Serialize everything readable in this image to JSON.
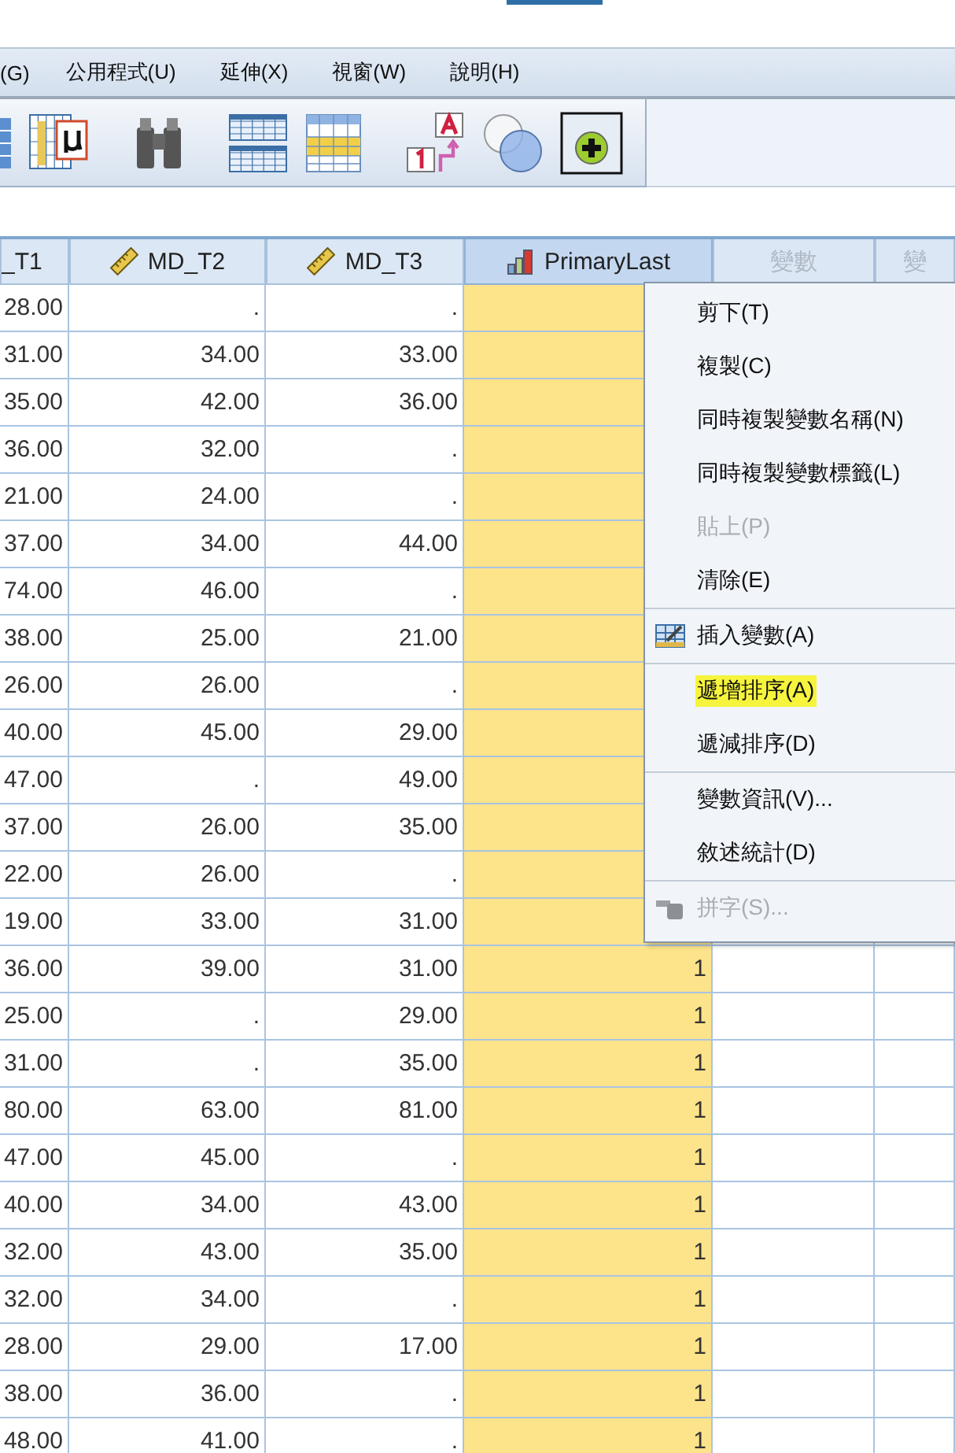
{
  "menu_bar": [
    {
      "label": "(G)"
    },
    {
      "label": "公用程式(U)"
    },
    {
      "label": "延伸(X)"
    },
    {
      "label": "視窗(W)"
    },
    {
      "label": "說明(H)"
    }
  ],
  "table": {
    "columns": [
      {
        "label": "_T1",
        "kind": "none",
        "selected": false
      },
      {
        "label": "MD_T2",
        "kind": "scale",
        "selected": false
      },
      {
        "label": "MD_T3",
        "kind": "scale",
        "selected": false
      },
      {
        "label": "PrimaryLast",
        "kind": "nominal",
        "selected": true
      },
      {
        "label": "變數",
        "kind": "empty",
        "selected": false
      },
      {
        "label": "變",
        "kind": "empty",
        "selected": false
      }
    ],
    "rows": [
      [
        "28.00",
        ".",
        "."
      ],
      [
        "31.00",
        "34.00",
        "33.00"
      ],
      [
        "35.00",
        "42.00",
        "36.00"
      ],
      [
        "36.00",
        "32.00",
        "."
      ],
      [
        "21.00",
        "24.00",
        "."
      ],
      [
        "37.00",
        "34.00",
        "44.00"
      ],
      [
        "74.00",
        "46.00",
        "."
      ],
      [
        "38.00",
        "25.00",
        "21.00"
      ],
      [
        "26.00",
        "26.00",
        "."
      ],
      [
        "40.00",
        "45.00",
        "29.00"
      ],
      [
        "47.00",
        ".",
        "49.00"
      ],
      [
        "37.00",
        "26.00",
        "35.00"
      ],
      [
        "22.00",
        "26.00",
        "."
      ],
      [
        "19.00",
        "33.00",
        "31.00"
      ],
      [
        "36.00",
        "39.00",
        "31.00",
        "1"
      ],
      [
        "25.00",
        ".",
        "29.00",
        "1"
      ],
      [
        "31.00",
        ".",
        "35.00",
        "1"
      ],
      [
        "80.00",
        "63.00",
        "81.00",
        "1"
      ],
      [
        "47.00",
        "45.00",
        ".",
        "1"
      ],
      [
        "40.00",
        "34.00",
        "43.00",
        "1"
      ],
      [
        "32.00",
        "43.00",
        "35.00",
        "1"
      ],
      [
        "32.00",
        "34.00",
        ".",
        "1"
      ],
      [
        "28.00",
        "29.00",
        "17.00",
        "1"
      ],
      [
        "38.00",
        "36.00",
        ".",
        "1"
      ],
      [
        "48.00",
        "41.00",
        ".",
        "1"
      ]
    ]
  },
  "context_menu": [
    {
      "kind": "plain",
      "label": "剪下(T)",
      "disabled": false,
      "highlighted": false
    },
    {
      "kind": "plain",
      "label": "複製(C)",
      "disabled": false,
      "highlighted": false
    },
    {
      "kind": "plain",
      "label": "同時複製變數名稱(N)",
      "disabled": false,
      "highlighted": false
    },
    {
      "kind": "plain",
      "label": "同時複製變數標籤(L)",
      "disabled": false,
      "highlighted": false
    },
    {
      "kind": "plain",
      "label": "貼上(P)",
      "disabled": true,
      "highlighted": false
    },
    {
      "kind": "plain",
      "label": "清除(E)",
      "disabled": false,
      "highlighted": false
    },
    {
      "kind": "separator"
    },
    {
      "kind": "insert",
      "label": "插入變數(A)",
      "disabled": false,
      "highlighted": false
    },
    {
      "kind": "separator"
    },
    {
      "kind": "plain",
      "label": "遞增排序(A)",
      "disabled": false,
      "highlighted": true
    },
    {
      "kind": "plain",
      "label": "遞減排序(D)",
      "disabled": false,
      "highlighted": false
    },
    {
      "kind": "separator"
    },
    {
      "kind": "plain",
      "label": "變數資訊(V)...",
      "disabled": false,
      "highlighted": false
    },
    {
      "kind": "plain",
      "label": "敘述統計(D)",
      "disabled": false,
      "highlighted": false
    },
    {
      "kind": "separator"
    },
    {
      "kind": "spell",
      "label": "拼字(S)...",
      "disabled": true,
      "highlighted": false
    }
  ]
}
